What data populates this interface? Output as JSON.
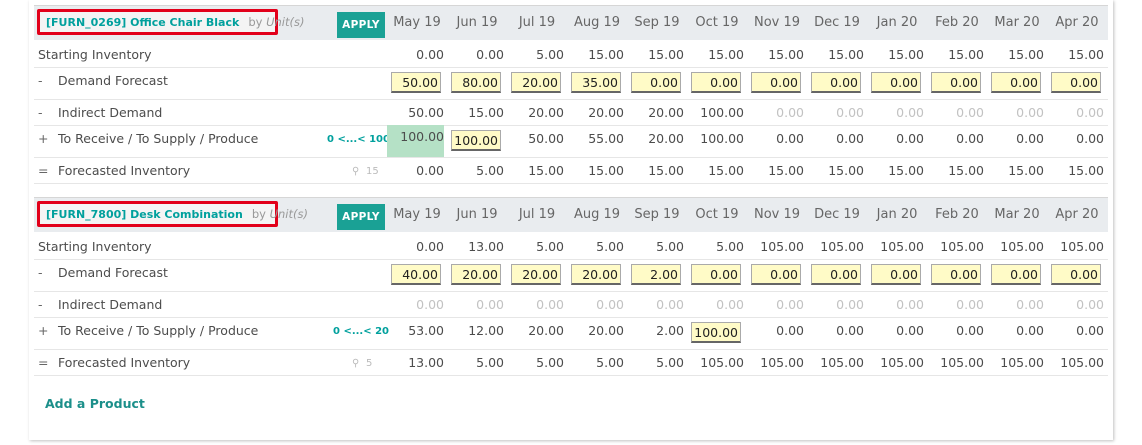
{
  "months": [
    "May 19",
    "Jun 19",
    "Jul 19",
    "Aug 19",
    "Sep 19",
    "Oct 19",
    "Nov 19",
    "Dec 19",
    "Jan 20",
    "Feb 20",
    "Mar 20",
    "Apr 20"
  ],
  "apply_label": "APPLY",
  "row_labels": {
    "starting": "Starting Inventory",
    "demand": "Demand Forecast",
    "indirect": "Indirect Demand",
    "receive": "To Receive / To Supply / Produce",
    "forecasted": "Forecasted Inventory"
  },
  "signs": {
    "demand": "-",
    "indirect": "-",
    "receive": "+",
    "forecasted": "="
  },
  "products": [
    {
      "name": "[FURN_0269] Office Chair Black",
      "by": "by",
      "unit": "Unit(s)",
      "range": "0 <...< 100",
      "safety": "15",
      "starting": [
        "0.00",
        "0.00",
        "5.00",
        "15.00",
        "15.00",
        "15.00",
        "15.00",
        "15.00",
        "15.00",
        "15.00",
        "15.00",
        "15.00"
      ],
      "demand": [
        "50.00",
        "80.00",
        "20.00",
        "35.00",
        "0.00",
        "0.00",
        "0.00",
        "0.00",
        "0.00",
        "0.00",
        "0.00",
        "0.00"
      ],
      "indirect": [
        "50.00",
        "15.00",
        "20.00",
        "20.00",
        "20.00",
        "100.00",
        "0.00",
        "0.00",
        "0.00",
        "0.00",
        "0.00",
        "0.00"
      ],
      "receive": [
        "100.00",
        "100.00",
        "50.00",
        "55.00",
        "20.00",
        "100.00",
        "0.00",
        "0.00",
        "0.00",
        "0.00",
        "0.00",
        "0.00"
      ],
      "forecasted": [
        "0.00",
        "5.00",
        "15.00",
        "15.00",
        "15.00",
        "15.00",
        "15.00",
        "15.00",
        "15.00",
        "15.00",
        "15.00",
        "15.00"
      ]
    },
    {
      "name": "[FURN_7800] Desk Combination",
      "by": "by",
      "unit": "Unit(s)",
      "range": "0 <...< 20",
      "safety": "5",
      "starting": [
        "0.00",
        "13.00",
        "5.00",
        "5.00",
        "5.00",
        "5.00",
        "105.00",
        "105.00",
        "105.00",
        "105.00",
        "105.00",
        "105.00"
      ],
      "demand": [
        "40.00",
        "20.00",
        "20.00",
        "20.00",
        "2.00",
        "0.00",
        "0.00",
        "0.00",
        "0.00",
        "0.00",
        "0.00",
        "0.00"
      ],
      "indirect": [
        "0.00",
        "0.00",
        "0.00",
        "0.00",
        "0.00",
        "0.00",
        "0.00",
        "0.00",
        "0.00",
        "0.00",
        "0.00",
        "0.00"
      ],
      "receive": [
        "53.00",
        "12.00",
        "20.00",
        "20.00",
        "2.00",
        "100.00",
        "0.00",
        "0.00",
        "0.00",
        "0.00",
        "0.00",
        "0.00"
      ],
      "forecasted": [
        "13.00",
        "5.00",
        "5.00",
        "5.00",
        "5.00",
        "105.00",
        "105.00",
        "105.00",
        "105.00",
        "105.00",
        "105.00",
        "105.00"
      ]
    }
  ],
  "add_product_label": "Add a Product",
  "icons": {
    "pin": "map-marker-icon"
  },
  "colors": {
    "accent": "#00a09d",
    "highlight": "#e2001a",
    "input_bg": "#fffbc7",
    "green_cell": "#b5e1c6"
  }
}
